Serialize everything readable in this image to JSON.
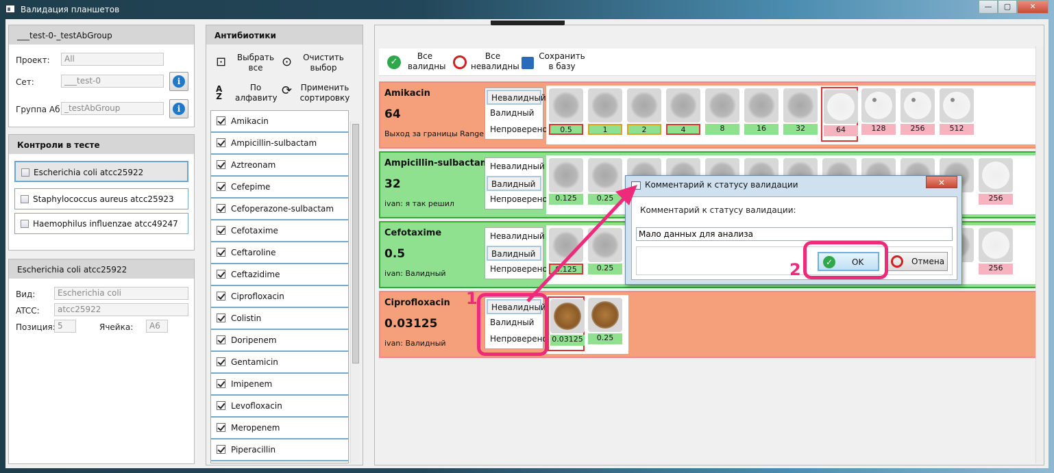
{
  "window": {
    "title": "Валидация планшетов"
  },
  "left": {
    "group_title": "___test-0-_testAbGroup",
    "project_label": "Проект:",
    "project_value": "All",
    "set_label": "Сет:",
    "set_value": "___test-0",
    "group_label": "Группа Аб:",
    "group_value": "_testAbGroup",
    "controls_title": "Контроли в тесте",
    "controls": [
      "Escherichia coli atcc25922",
      "Staphylococcus aureus atcc25923",
      "Haemophilus influenzae atcc49247"
    ],
    "detail_title": "Escherichia coli atcc25922",
    "species_label": "Вид:",
    "species_value": "Escherichia coli",
    "atcc_label": "ATCC:",
    "atcc_value": "atcc25922",
    "position_label": "Позиция:",
    "position_value": "5",
    "cell_label": "Ячейка:",
    "cell_value": "A6"
  },
  "antibiotics": {
    "title": "Антибиотики",
    "select_all": "Выбрать все",
    "clear": "Очистить выбор",
    "alpha": "По алфавиту",
    "apply_sort": "Применить сортировку",
    "items": [
      "Amikacin",
      "Ampicillin-sulbactam",
      "Aztreonam",
      "Cefepime",
      "Cefoperazone-sulbactam",
      "Cefotaxime",
      "Ceftaroline",
      "Ceftazidime",
      "Ciprofloxacin",
      "Colistin",
      "Doripenem",
      "Gentamicin",
      "Imipenem",
      "Levofloxacin",
      "Meropenem",
      "Piperacillin"
    ]
  },
  "toolbar": {
    "all_valid": "Все валидны",
    "all_invalid": "Все невалидны",
    "save": "Сохранить в базу"
  },
  "status_options": [
    "Невалидный",
    "Валидный",
    "Непроверено"
  ],
  "cards": [
    {
      "name": "Amikacin",
      "value": "64",
      "note": "Выход за границы Range",
      "wells": [
        "0.5",
        "1",
        "2",
        "4",
        "8",
        "16",
        "32",
        "64",
        "128",
        "256",
        "512"
      ]
    },
    {
      "name": "Ampicillin-sulbactam",
      "value": "32",
      "note": "ivan:  я так решил",
      "wells": [
        "0.125",
        "0.25",
        "256"
      ]
    },
    {
      "name": "Cefotaxime",
      "value": "0.5",
      "note": "ivan:  Валидный",
      "wells": [
        "0.125",
        "0.25",
        "256"
      ]
    },
    {
      "name": "Ciprofloxacin",
      "value": "0.03125",
      "note": "ivan:  Валидный",
      "wells": [
        "0.03125",
        "0.25"
      ]
    }
  ],
  "dialog": {
    "title": "Комментарий к статусу валидации",
    "label": "Комментарий к статусу валидации:",
    "input_value": "Мало данных для анализа",
    "ok": "OK",
    "cancel": "Отмена"
  },
  "annotations": {
    "one": "1",
    "two": "2"
  },
  "colors": {
    "invalid_card": "#f5a07a",
    "valid_card": "#8fe08f",
    "highlight": "#ee2a7b"
  }
}
